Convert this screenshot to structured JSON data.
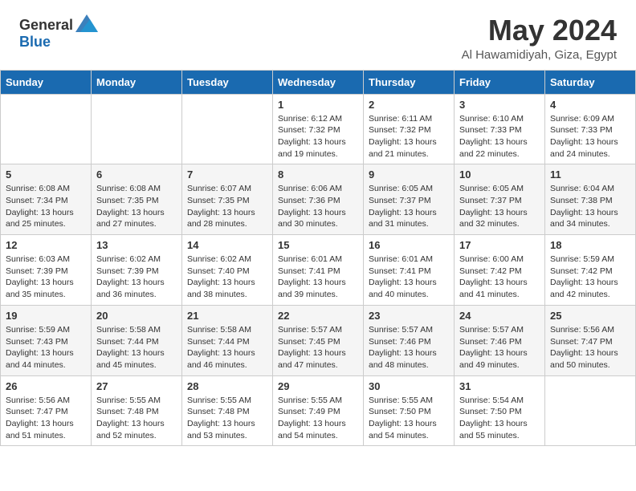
{
  "header": {
    "logo_general": "General",
    "logo_blue": "Blue",
    "month": "May 2024",
    "location": "Al Hawamidiyah, Giza, Egypt"
  },
  "days_of_week": [
    "Sunday",
    "Monday",
    "Tuesday",
    "Wednesday",
    "Thursday",
    "Friday",
    "Saturday"
  ],
  "weeks": [
    [
      {
        "date": "",
        "sunrise": "",
        "sunset": "",
        "daylight": ""
      },
      {
        "date": "",
        "sunrise": "",
        "sunset": "",
        "daylight": ""
      },
      {
        "date": "",
        "sunrise": "",
        "sunset": "",
        "daylight": ""
      },
      {
        "date": "1",
        "sunrise": "Sunrise: 6:12 AM",
        "sunset": "Sunset: 7:32 PM",
        "daylight": "Daylight: 13 hours and 19 minutes."
      },
      {
        "date": "2",
        "sunrise": "Sunrise: 6:11 AM",
        "sunset": "Sunset: 7:32 PM",
        "daylight": "Daylight: 13 hours and 21 minutes."
      },
      {
        "date": "3",
        "sunrise": "Sunrise: 6:10 AM",
        "sunset": "Sunset: 7:33 PM",
        "daylight": "Daylight: 13 hours and 22 minutes."
      },
      {
        "date": "4",
        "sunrise": "Sunrise: 6:09 AM",
        "sunset": "Sunset: 7:33 PM",
        "daylight": "Daylight: 13 hours and 24 minutes."
      }
    ],
    [
      {
        "date": "5",
        "sunrise": "Sunrise: 6:08 AM",
        "sunset": "Sunset: 7:34 PM",
        "daylight": "Daylight: 13 hours and 25 minutes."
      },
      {
        "date": "6",
        "sunrise": "Sunrise: 6:08 AM",
        "sunset": "Sunset: 7:35 PM",
        "daylight": "Daylight: 13 hours and 27 minutes."
      },
      {
        "date": "7",
        "sunrise": "Sunrise: 6:07 AM",
        "sunset": "Sunset: 7:35 PM",
        "daylight": "Daylight: 13 hours and 28 minutes."
      },
      {
        "date": "8",
        "sunrise": "Sunrise: 6:06 AM",
        "sunset": "Sunset: 7:36 PM",
        "daylight": "Daylight: 13 hours and 30 minutes."
      },
      {
        "date": "9",
        "sunrise": "Sunrise: 6:05 AM",
        "sunset": "Sunset: 7:37 PM",
        "daylight": "Daylight: 13 hours and 31 minutes."
      },
      {
        "date": "10",
        "sunrise": "Sunrise: 6:05 AM",
        "sunset": "Sunset: 7:37 PM",
        "daylight": "Daylight: 13 hours and 32 minutes."
      },
      {
        "date": "11",
        "sunrise": "Sunrise: 6:04 AM",
        "sunset": "Sunset: 7:38 PM",
        "daylight": "Daylight: 13 hours and 34 minutes."
      }
    ],
    [
      {
        "date": "12",
        "sunrise": "Sunrise: 6:03 AM",
        "sunset": "Sunset: 7:39 PM",
        "daylight": "Daylight: 13 hours and 35 minutes."
      },
      {
        "date": "13",
        "sunrise": "Sunrise: 6:02 AM",
        "sunset": "Sunset: 7:39 PM",
        "daylight": "Daylight: 13 hours and 36 minutes."
      },
      {
        "date": "14",
        "sunrise": "Sunrise: 6:02 AM",
        "sunset": "Sunset: 7:40 PM",
        "daylight": "Daylight: 13 hours and 38 minutes."
      },
      {
        "date": "15",
        "sunrise": "Sunrise: 6:01 AM",
        "sunset": "Sunset: 7:41 PM",
        "daylight": "Daylight: 13 hours and 39 minutes."
      },
      {
        "date": "16",
        "sunrise": "Sunrise: 6:01 AM",
        "sunset": "Sunset: 7:41 PM",
        "daylight": "Daylight: 13 hours and 40 minutes."
      },
      {
        "date": "17",
        "sunrise": "Sunrise: 6:00 AM",
        "sunset": "Sunset: 7:42 PM",
        "daylight": "Daylight: 13 hours and 41 minutes."
      },
      {
        "date": "18",
        "sunrise": "Sunrise: 5:59 AM",
        "sunset": "Sunset: 7:42 PM",
        "daylight": "Daylight: 13 hours and 42 minutes."
      }
    ],
    [
      {
        "date": "19",
        "sunrise": "Sunrise: 5:59 AM",
        "sunset": "Sunset: 7:43 PM",
        "daylight": "Daylight: 13 hours and 44 minutes."
      },
      {
        "date": "20",
        "sunrise": "Sunrise: 5:58 AM",
        "sunset": "Sunset: 7:44 PM",
        "daylight": "Daylight: 13 hours and 45 minutes."
      },
      {
        "date": "21",
        "sunrise": "Sunrise: 5:58 AM",
        "sunset": "Sunset: 7:44 PM",
        "daylight": "Daylight: 13 hours and 46 minutes."
      },
      {
        "date": "22",
        "sunrise": "Sunrise: 5:57 AM",
        "sunset": "Sunset: 7:45 PM",
        "daylight": "Daylight: 13 hours and 47 minutes."
      },
      {
        "date": "23",
        "sunrise": "Sunrise: 5:57 AM",
        "sunset": "Sunset: 7:46 PM",
        "daylight": "Daylight: 13 hours and 48 minutes."
      },
      {
        "date": "24",
        "sunrise": "Sunrise: 5:57 AM",
        "sunset": "Sunset: 7:46 PM",
        "daylight": "Daylight: 13 hours and 49 minutes."
      },
      {
        "date": "25",
        "sunrise": "Sunrise: 5:56 AM",
        "sunset": "Sunset: 7:47 PM",
        "daylight": "Daylight: 13 hours and 50 minutes."
      }
    ],
    [
      {
        "date": "26",
        "sunrise": "Sunrise: 5:56 AM",
        "sunset": "Sunset: 7:47 PM",
        "daylight": "Daylight: 13 hours and 51 minutes."
      },
      {
        "date": "27",
        "sunrise": "Sunrise: 5:55 AM",
        "sunset": "Sunset: 7:48 PM",
        "daylight": "Daylight: 13 hours and 52 minutes."
      },
      {
        "date": "28",
        "sunrise": "Sunrise: 5:55 AM",
        "sunset": "Sunset: 7:48 PM",
        "daylight": "Daylight: 13 hours and 53 minutes."
      },
      {
        "date": "29",
        "sunrise": "Sunrise: 5:55 AM",
        "sunset": "Sunset: 7:49 PM",
        "daylight": "Daylight: 13 hours and 54 minutes."
      },
      {
        "date": "30",
        "sunrise": "Sunrise: 5:55 AM",
        "sunset": "Sunset: 7:50 PM",
        "daylight": "Daylight: 13 hours and 54 minutes."
      },
      {
        "date": "31",
        "sunrise": "Sunrise: 5:54 AM",
        "sunset": "Sunset: 7:50 PM",
        "daylight": "Daylight: 13 hours and 55 minutes."
      },
      {
        "date": "",
        "sunrise": "",
        "sunset": "",
        "daylight": ""
      }
    ]
  ]
}
